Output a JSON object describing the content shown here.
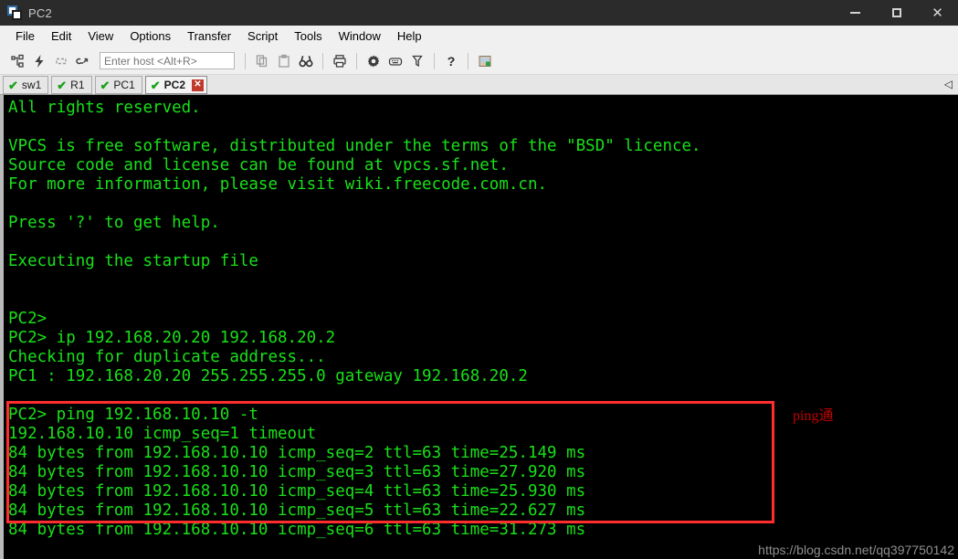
{
  "window": {
    "title": "PC2",
    "icon": "cascading-windows-icon",
    "controls": {
      "minimize": "–",
      "maximize": "□",
      "close": "✕"
    }
  },
  "menubar": {
    "items": [
      {
        "label": "File"
      },
      {
        "label": "Edit"
      },
      {
        "label": "View"
      },
      {
        "label": "Options"
      },
      {
        "label": "Transfer"
      },
      {
        "label": "Script"
      },
      {
        "label": "Tools"
      },
      {
        "label": "Window"
      },
      {
        "label": "Help"
      }
    ]
  },
  "toolbar": {
    "host_input": {
      "value": "",
      "placeholder": "Enter host <Alt+R>"
    },
    "icons": [
      "connect-session-icon",
      "quick-connect-icon",
      "reconnect-icon",
      "disconnect-icon",
      "copy-icon",
      "paste-icon",
      "find-icon",
      "print-icon",
      "session-options-icon",
      "keymap-editor-icon",
      "filter-icon",
      "help-icon",
      "session-manager-icon"
    ]
  },
  "tabs": {
    "items": [
      {
        "label": "sw1",
        "active": false,
        "status": "connected"
      },
      {
        "label": "R1",
        "active": false,
        "status": "connected"
      },
      {
        "label": "PC1",
        "active": false,
        "status": "connected"
      },
      {
        "label": "PC2",
        "active": true,
        "status": "connected"
      }
    ],
    "close_label": "✕",
    "check_glyph": "✔",
    "scroll_arrow": "◁"
  },
  "terminal": {
    "foreground": "#19e019",
    "background": "#000000",
    "lines": [
      "All rights reserved.",
      "",
      "VPCS is free software, distributed under the terms of the \"BSD\" licence.",
      "Source code and license can be found at vpcs.sf.net.",
      "For more information, please visit wiki.freecode.com.cn.",
      "",
      "Press '?' to get help.",
      "",
      "Executing the startup file",
      "",
      "",
      "PC2> ",
      "PC2> ip 192.168.20.20 192.168.20.2",
      "Checking for duplicate address...",
      "PC1 : 192.168.20.20 255.255.255.0 gateway 192.168.20.2",
      "",
      "PC2> ping 192.168.10.10 -t",
      "192.168.10.10 icmp_seq=1 timeout",
      "84 bytes from 192.168.10.10 icmp_seq=2 ttl=63 time=25.149 ms",
      "84 bytes from 192.168.10.10 icmp_seq=3 ttl=63 time=27.920 ms",
      "84 bytes from 192.168.10.10 icmp_seq=4 ttl=63 time=25.930 ms",
      "84 bytes from 192.168.10.10 icmp_seq=5 ttl=63 time=22.627 ms",
      "84 bytes from 192.168.10.10 icmp_seq=6 ttl=63 time=31.273 ms"
    ]
  },
  "annotations": {
    "highlight_box_color": "#ff2d2d",
    "note_text": "ping通",
    "note_color": "#c00000"
  },
  "watermark": {
    "text": "https://blog.csdn.net/qq397750142"
  }
}
